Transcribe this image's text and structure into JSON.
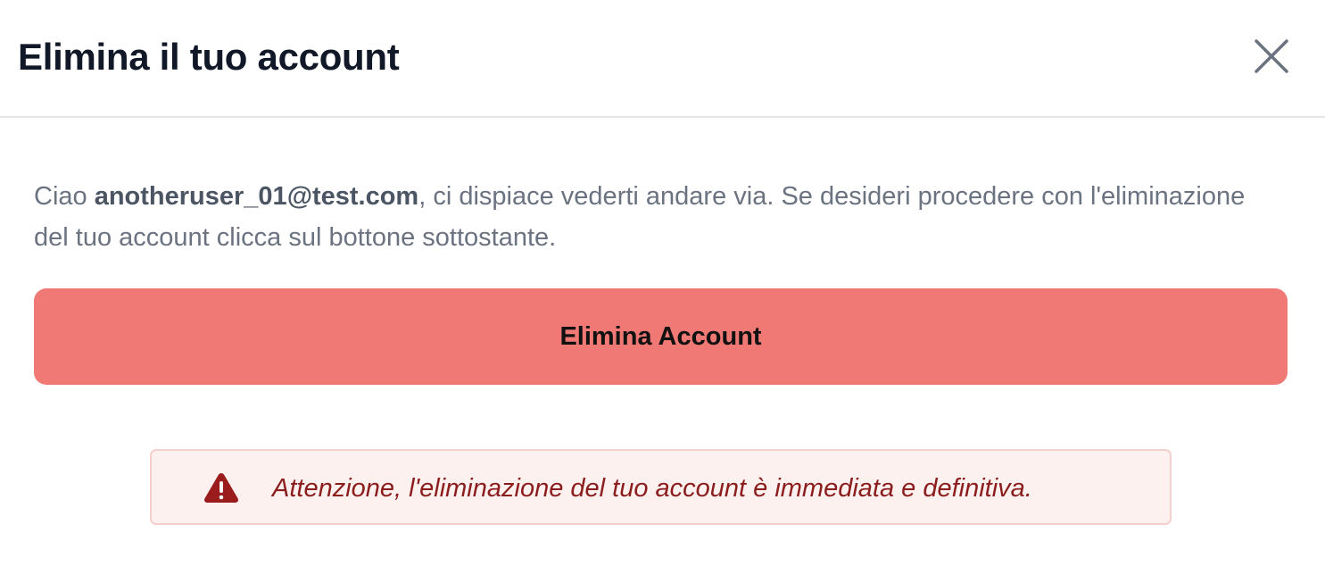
{
  "modal": {
    "title": "Elimina il tuo account",
    "close_icon": "close-icon"
  },
  "message": {
    "greeting": "Ciao ",
    "email": "anotheruser_01@test.com",
    "text": ", ci dispiace vederti andare via. Se desideri procedere con l'eliminazione del tuo account clicca sul bottone sottostante."
  },
  "delete_button": {
    "label": "Elimina Account",
    "color": "#f07975"
  },
  "alert": {
    "icon": "warning-triangle-icon",
    "text": "Attenzione, l'eliminazione del tuo account è immediata e definitiva.",
    "text_color": "#8b1d1d",
    "background": "#fdf1f0",
    "border_color": "#f6cfcc"
  }
}
